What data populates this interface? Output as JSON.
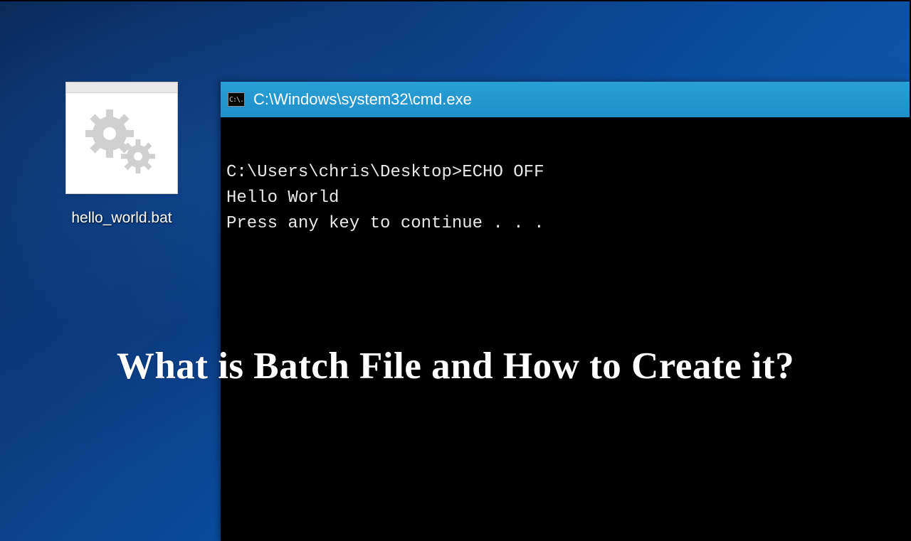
{
  "desktop": {
    "file_label": "hello_world.bat"
  },
  "cmd": {
    "icon_text": "C:\\.",
    "title": "C:\\Windows\\system32\\cmd.exe",
    "lines": {
      "l1": "C:\\Users\\chris\\Desktop>ECHO OFF",
      "l2": "Hello World",
      "l3": "Press any key to continue . . ."
    }
  },
  "headline": "What is Batch File and How to Create it?"
}
